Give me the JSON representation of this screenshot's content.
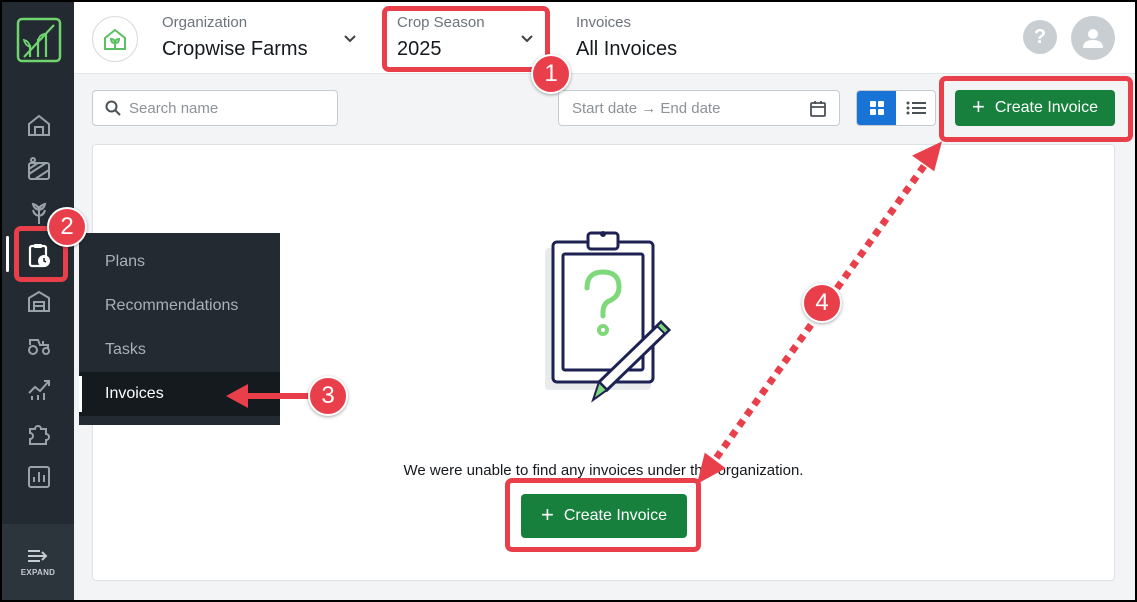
{
  "sidebar": {
    "logo_icon": "plant-growth-logo-icon",
    "items": [
      {
        "name": "home-icon"
      },
      {
        "name": "field-icon"
      },
      {
        "name": "crop-icon"
      },
      {
        "name": "clipboard-clock-icon"
      },
      {
        "name": "warehouse-icon"
      },
      {
        "name": "tractor-icon"
      },
      {
        "name": "analytics-icon"
      },
      {
        "name": "puzzle-icon"
      },
      {
        "name": "report-chart-icon"
      }
    ],
    "expand_label": "EXPAND"
  },
  "header": {
    "organization_label": "Organization",
    "organization_value": "Cropwise Farms",
    "season_label": "Crop Season",
    "season_value": "2025",
    "breadcrumb_label": "Invoices",
    "page_title": "All Invoices"
  },
  "toolbar": {
    "search_placeholder": "Search name",
    "date_placeholder": "Start date → End date",
    "create_label": "Create Invoice"
  },
  "flyout": {
    "items": [
      "Plans",
      "Recommendations",
      "Tasks",
      "Invoices"
    ],
    "active": "Invoices"
  },
  "empty_state": {
    "message": "We were unable to find any invoices under this organization.",
    "create_label": "Create Invoice"
  },
  "annotations": {
    "steps": [
      "1",
      "2",
      "3",
      "4"
    ],
    "color": "#e93f4b"
  },
  "colors": {
    "primary_green": "#16803c",
    "toggle_blue": "#1773d6",
    "sidebar_bg": "#232a31"
  }
}
